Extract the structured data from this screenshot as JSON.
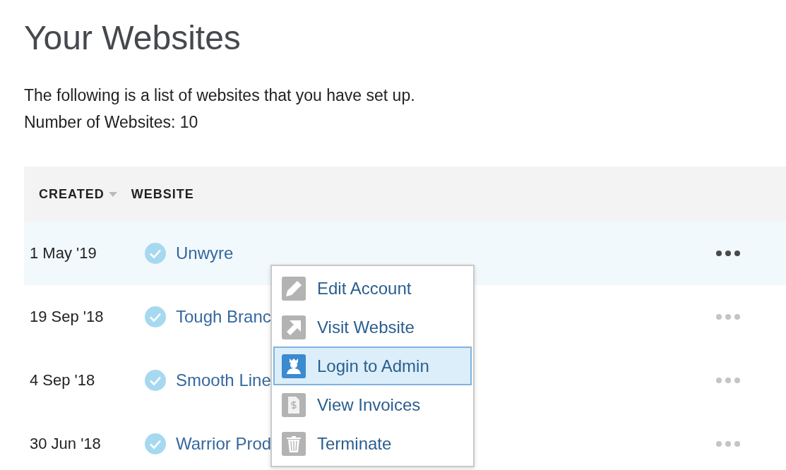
{
  "title": "Your Websites",
  "intro": "The following is a list of websites that you have set up.",
  "count": "Number of Websites: 10",
  "table": {
    "columns": [
      {
        "label": "CREATED",
        "sorted": true
      },
      {
        "label": "WEBSITE",
        "sorted": false
      }
    ],
    "rows": [
      {
        "created": "1 May '19",
        "website": "Unwyre",
        "verified": true,
        "selected": true
      },
      {
        "created": "19 Sep '18",
        "website": "Tough Branc",
        "verified": true,
        "selected": false
      },
      {
        "created": "4 Sep '18",
        "website": "Smooth Line",
        "verified": true,
        "selected": false
      },
      {
        "created": "30 Jun '18",
        "website": "Warrior Prod",
        "verified": true,
        "selected": false
      }
    ]
  },
  "menu": {
    "items": [
      {
        "kind": "edit",
        "label": "Edit Account",
        "selected": false
      },
      {
        "kind": "visit",
        "label": "Visit Website",
        "selected": false
      },
      {
        "kind": "admin",
        "label": "Login to Admin",
        "selected": true
      },
      {
        "kind": "invoice",
        "label": "View Invoices",
        "selected": false
      },
      {
        "kind": "trash",
        "label": "Terminate",
        "selected": false
      }
    ]
  }
}
